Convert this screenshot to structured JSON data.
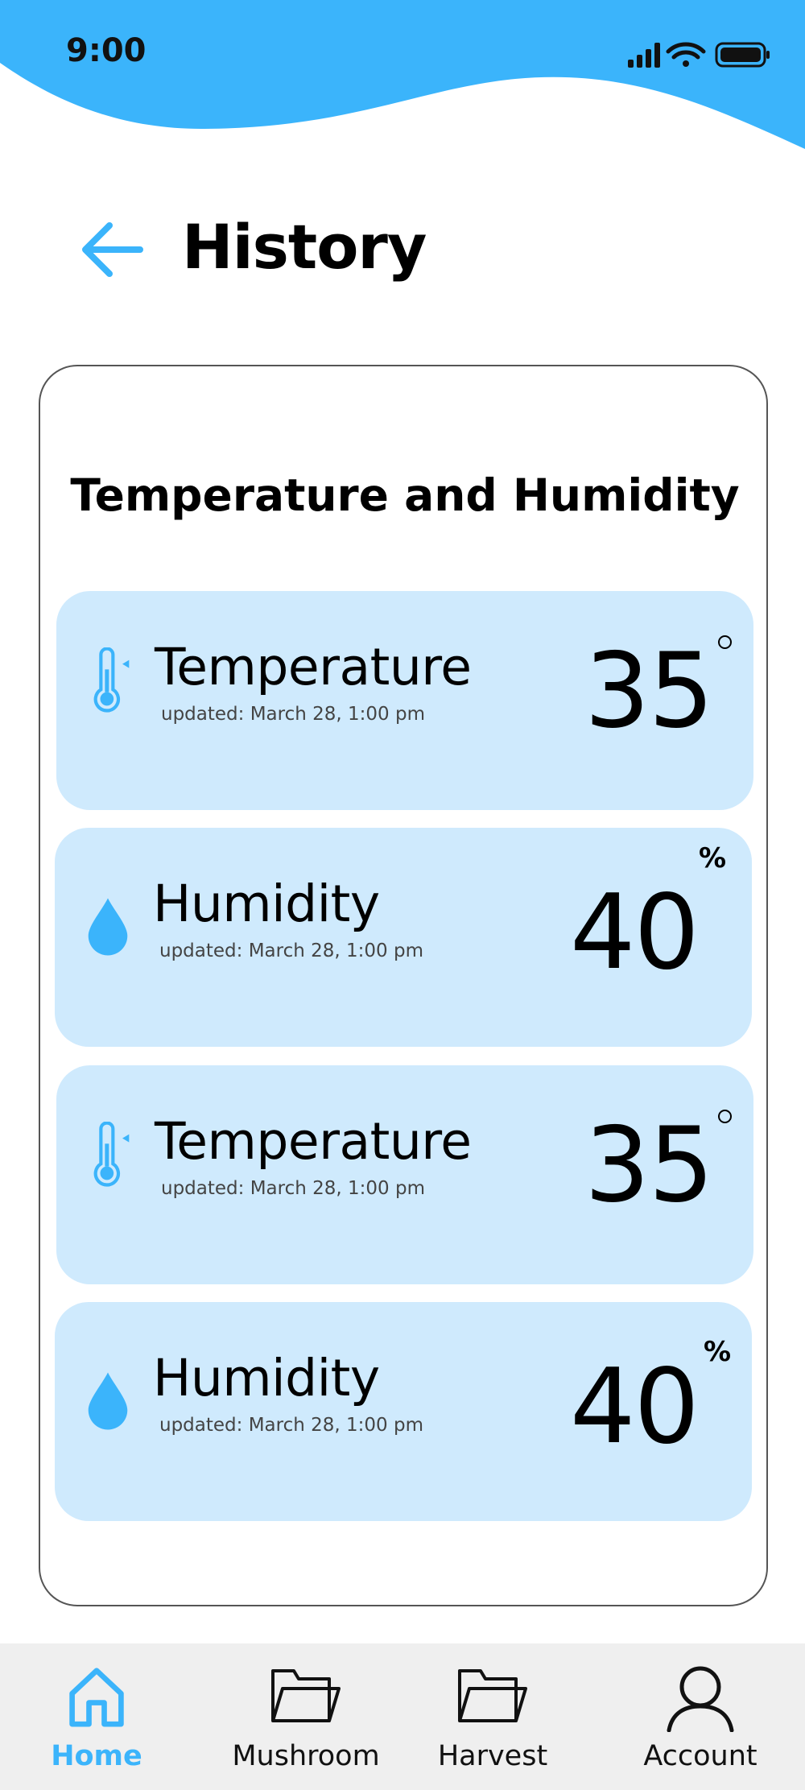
{
  "status_bar": {
    "time": "9:00"
  },
  "header": {
    "title": "History"
  },
  "panel": {
    "title": "Temperature and Humidity",
    "cards": [
      {
        "type": "temperature",
        "icon": "thermometer-icon",
        "label": "Temperature",
        "updated": "updated: March 28, 1:00 pm",
        "value": "35",
        "unit": "degree"
      },
      {
        "type": "humidity",
        "icon": "water-drop-icon",
        "label": "Humidity",
        "updated": "updated: March 28, 1:00 pm",
        "value": "40",
        "unit": "%"
      },
      {
        "type": "temperature",
        "icon": "thermometer-icon",
        "label": "Temperature",
        "updated": "updated: March 28, 1:00 pm",
        "value": "35",
        "unit": "degree"
      },
      {
        "type": "humidity",
        "icon": "water-drop-icon",
        "label": "Humidity",
        "updated": "updated: March 28, 1:00 pm",
        "value": "40",
        "unit": "%"
      }
    ]
  },
  "nav": {
    "items": [
      {
        "label": "Home",
        "icon": "home-icon",
        "active": true
      },
      {
        "label": "Mushroom",
        "icon": "folder-icon",
        "active": false
      },
      {
        "label": "Harvest",
        "icon": "folder-icon",
        "active": false
      },
      {
        "label": "Account",
        "icon": "user-icon",
        "active": false
      }
    ]
  },
  "colors": {
    "accent": "#3bb4fb",
    "card_bg": "#cfeafd",
    "nav_bg": "#efefef"
  }
}
